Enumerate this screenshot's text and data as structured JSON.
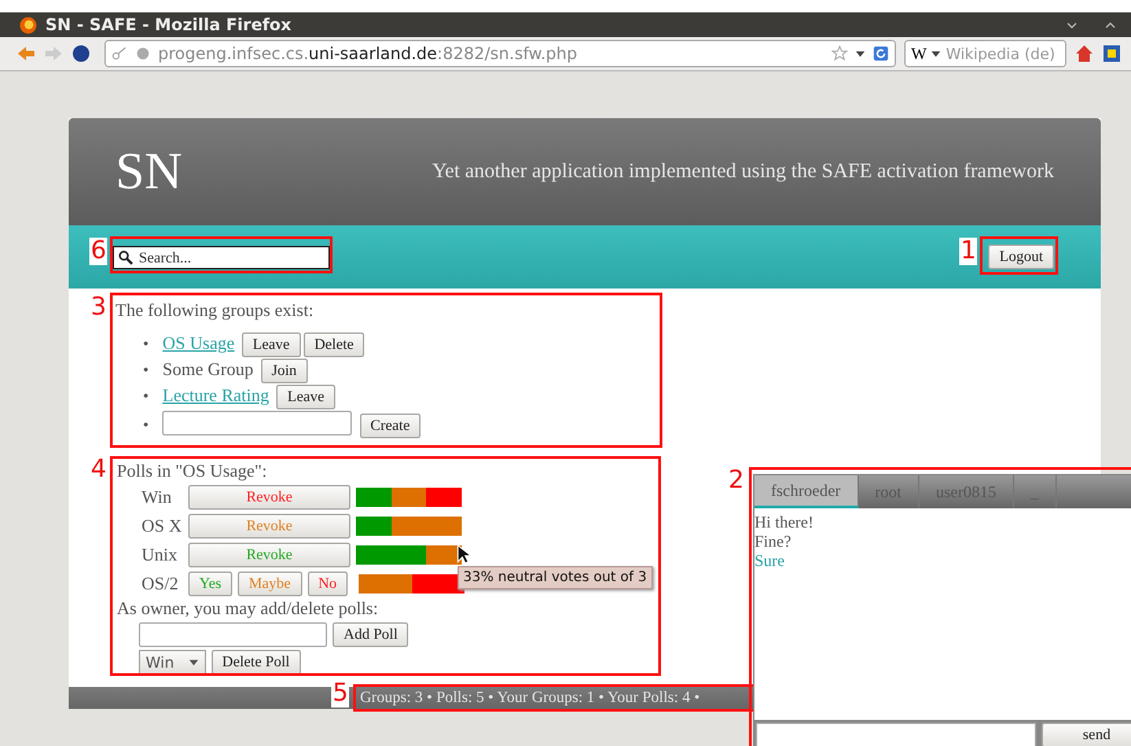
{
  "window": {
    "title": "SN - SAFE - Mozilla Firefox"
  },
  "browser": {
    "url": {
      "prefix": "progeng.infsec.cs.",
      "domain": "uni-saarland.de",
      "suffix": ":8282/sn.sfw.php"
    },
    "search_engine": "Wikipedia (de)",
    "search_letter": "W"
  },
  "header": {
    "logo": "SN",
    "tagline": "Yet another application implemented using the SAFE activation framework"
  },
  "toolbar": {
    "search": {
      "placeholder": "Search..."
    },
    "logout": "Logout"
  },
  "groups": {
    "heading": "The following groups exist:",
    "items": [
      {
        "bullet": "•",
        "name": "OS Usage",
        "member": true,
        "actions": [
          "Leave",
          "Delete"
        ]
      },
      {
        "bullet": "•",
        "name": "Some Group",
        "member": false,
        "actions": [
          "Join"
        ]
      },
      {
        "bullet": "•",
        "name": "Lecture Rating",
        "member": true,
        "actions": [
          "Leave"
        ]
      }
    ],
    "create_bullet": "•",
    "create_button": "Create"
  },
  "polls": {
    "heading": "Polls in \"OS Usage\":",
    "items": [
      {
        "name": "Win",
        "kind": "voted",
        "color": "#ff2020",
        "buttons": [
          "Revoke"
        ],
        "segments": [
          {
            "color": "#009900"
          },
          {
            "color": "#dd7000"
          },
          {
            "color": "#ff0000"
          }
        ]
      },
      {
        "name": "OS X",
        "kind": "voted",
        "color": "#e08020",
        "buttons": [
          "Revoke"
        ],
        "segments": [
          {
            "color": "#009900"
          },
          {
            "color": "#dd7000"
          },
          {
            "color": "#dd7000"
          }
        ]
      },
      {
        "name": "Unix",
        "kind": "voted",
        "color": "#22aa22",
        "buttons": [
          "Revoke"
        ],
        "segments": [
          {
            "color": "#009900"
          },
          {
            "color": "#009900"
          },
          {
            "color": "#dd7000"
          }
        ]
      },
      {
        "name": "OS/2",
        "kind": "open",
        "buttons": [
          "Yes",
          "Maybe",
          "No"
        ],
        "segments": [
          {
            "color": "#dd7000"
          },
          {
            "color": "#ff0000"
          }
        ]
      }
    ],
    "owner_note": "As owner, you may add/delete polls:",
    "add_button": "Add Poll",
    "select_value": "Win",
    "delete_button": "Delete Poll"
  },
  "tooltip": "33% neutral votes out of 3",
  "footer": "Groups: 3 • Polls: 5 • Your Groups: 1 • Your Polls: 4 •",
  "chat": {
    "tabs": [
      {
        "label": "fschroeder",
        "selected": true
      },
      {
        "label": "root",
        "selected": false
      },
      {
        "label": "user0815",
        "selected": false
      },
      {
        "label": "_",
        "selected": false
      }
    ],
    "messages": [
      {
        "text": "Hi there!",
        "mine": false
      },
      {
        "text": "Fine?",
        "mine": false
      },
      {
        "text": "Sure",
        "mine": true
      }
    ],
    "send": "send"
  },
  "annotations": [
    "1",
    "2",
    "3",
    "4",
    "5",
    "6"
  ]
}
